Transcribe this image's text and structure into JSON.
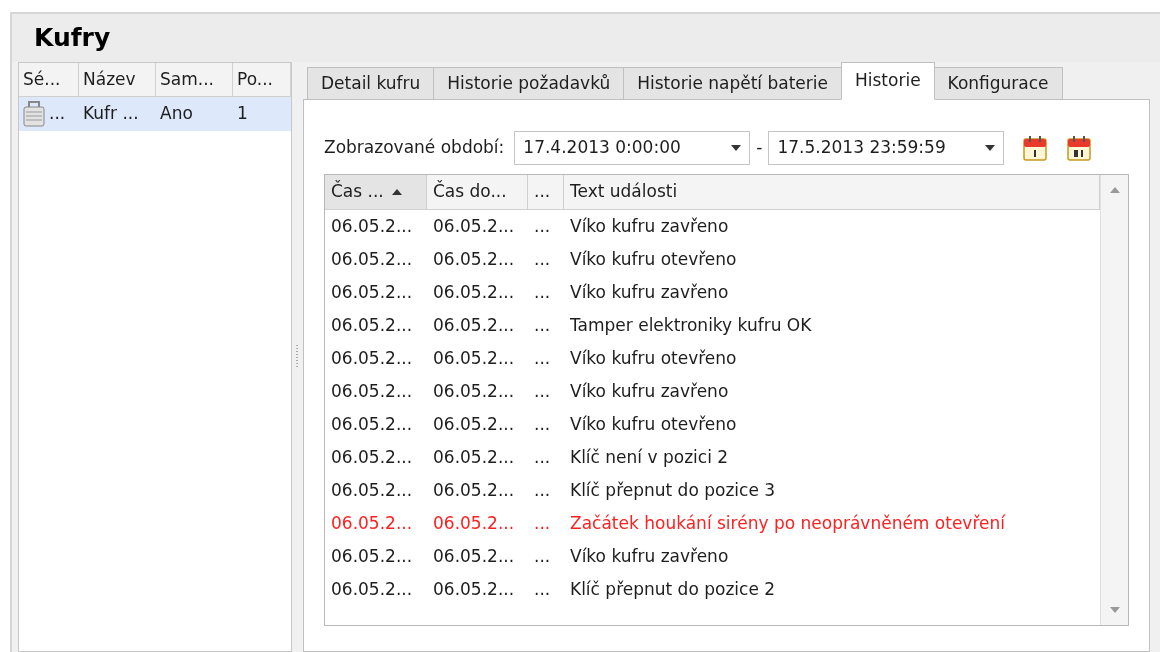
{
  "title": "Kufry",
  "left_table": {
    "columns": [
      "Sé...",
      "Název",
      "Sam...",
      "Po..."
    ],
    "rows": [
      {
        "cells": [
          "...",
          "Kufr ...",
          "Ano",
          "1"
        ],
        "selected": true
      }
    ]
  },
  "tabs": [
    {
      "label": "Detail kufru",
      "selected": false
    },
    {
      "label": "Historie požadavků",
      "selected": false
    },
    {
      "label": "Historie napětí baterie",
      "selected": false
    },
    {
      "label": "Historie",
      "selected": true
    },
    {
      "label": "Konfigurace",
      "selected": false
    }
  ],
  "period": {
    "label": "Zobrazované období:",
    "from": "17.4.2013 0:00:00",
    "separator": "-",
    "to": "17.5.2013 23:59:59"
  },
  "grid": {
    "columns": [
      {
        "label": "Čas ...",
        "sorted": true
      },
      {
        "label": "Čas do...",
        "sorted": false
      },
      {
        "label": "...",
        "sorted": false
      },
      {
        "label": "Text události",
        "sorted": false
      }
    ],
    "rows": [
      {
        "cells": [
          "06.05.2...",
          "06.05.2...",
          "...",
          "Víko kufru zavřeno"
        ],
        "alert": false
      },
      {
        "cells": [
          "06.05.2...",
          "06.05.2...",
          "...",
          "Víko kufru otevřeno"
        ],
        "alert": false
      },
      {
        "cells": [
          "06.05.2...",
          "06.05.2...",
          "...",
          "Víko kufru zavřeno"
        ],
        "alert": false
      },
      {
        "cells": [
          "06.05.2...",
          "06.05.2...",
          "...",
          "Tamper elektroniky kufru OK"
        ],
        "alert": false
      },
      {
        "cells": [
          "06.05.2...",
          "06.05.2...",
          "...",
          "Víko kufru otevřeno"
        ],
        "alert": false
      },
      {
        "cells": [
          "06.05.2...",
          "06.05.2...",
          "...",
          "Víko kufru zavřeno"
        ],
        "alert": false
      },
      {
        "cells": [
          "06.05.2...",
          "06.05.2...",
          "...",
          "Víko kufru otevřeno"
        ],
        "alert": false
      },
      {
        "cells": [
          "06.05.2...",
          "06.05.2...",
          "...",
          "Klíč není v pozici 2"
        ],
        "alert": false
      },
      {
        "cells": [
          "06.05.2...",
          "06.05.2...",
          "...",
          "Klíč přepnut do pozice 3"
        ],
        "alert": false
      },
      {
        "cells": [
          "06.05.2...",
          "06.05.2...",
          "...",
          "Začátek houkání sirény po neoprávněném otevření"
        ],
        "alert": true
      },
      {
        "cells": [
          "06.05.2...",
          "06.05.2...",
          "...",
          "Víko kufru zavřeno"
        ],
        "alert": false
      },
      {
        "cells": [
          "06.05.2...",
          "06.05.2...",
          "...",
          "Klíč přepnut do pozice 2"
        ],
        "alert": false
      }
    ]
  }
}
